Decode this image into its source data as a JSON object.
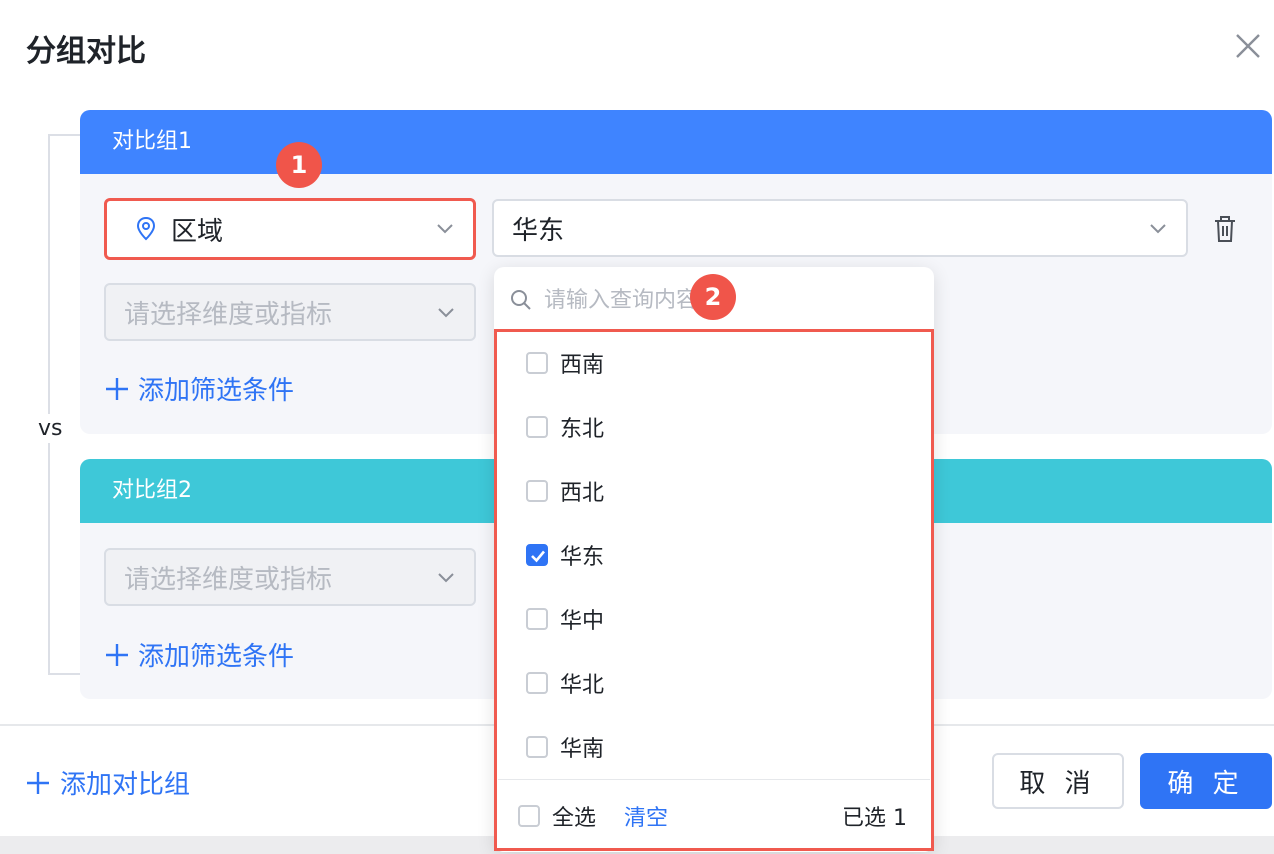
{
  "dialog": {
    "title": "分组对比"
  },
  "vs_label": "vs",
  "groups": [
    {
      "title": "对比组1",
      "dimension_select": {
        "value": "区域"
      },
      "value_select": {
        "value": "华东"
      },
      "second_select": {
        "placeholder": "请选择维度或指标"
      },
      "add_filter": "添加筛选条件"
    },
    {
      "title": "对比组2",
      "second_select": {
        "placeholder": "请选择维度或指标"
      },
      "add_filter": "添加筛选条件"
    }
  ],
  "dropdown": {
    "search_placeholder": "请输入查询内容",
    "options": [
      {
        "label": "西南",
        "checked": false
      },
      {
        "label": "东北",
        "checked": false
      },
      {
        "label": "西北",
        "checked": false
      },
      {
        "label": "华东",
        "checked": true
      },
      {
        "label": "华中",
        "checked": false
      },
      {
        "label": "华北",
        "checked": false
      },
      {
        "label": "华南",
        "checked": false
      }
    ],
    "select_all": "全选",
    "clear": "清空",
    "selected_count": "已选 1"
  },
  "badges": [
    "1",
    "2"
  ],
  "footer": {
    "add_group": "添加对比组",
    "cancel": "取 消",
    "confirm": "确 定"
  },
  "colors": {
    "primary": "#2f74f5",
    "group1_header": "#3f84ff",
    "group2_header": "#3ec8d8",
    "annotation_red": "#f05a4f"
  }
}
